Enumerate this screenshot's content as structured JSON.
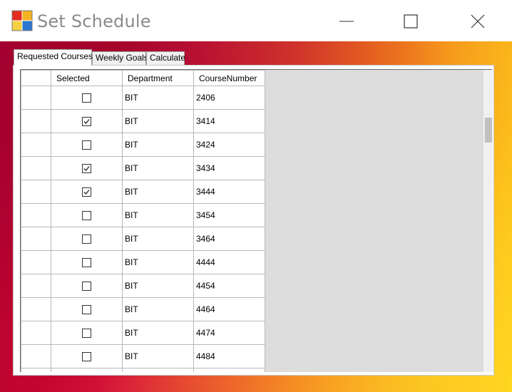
{
  "window": {
    "title": "Set Schedule",
    "accent_colors": [
      "#b70033",
      "#e8442b",
      "#ffd11a"
    ]
  },
  "tabs": [
    {
      "label": "Requested Courses",
      "active": true
    },
    {
      "label": "Weekly Goals",
      "active": false
    },
    {
      "label": "Calculate",
      "active": false
    }
  ],
  "grid": {
    "columns": [
      "Selected",
      "Department",
      "CourseNumber"
    ],
    "rows": [
      {
        "selected": false,
        "department": "BIT",
        "course_number": "2406"
      },
      {
        "selected": true,
        "department": "BIT",
        "course_number": "3414"
      },
      {
        "selected": false,
        "department": "BIT",
        "course_number": "3424"
      },
      {
        "selected": true,
        "department": "BIT",
        "course_number": "3434"
      },
      {
        "selected": true,
        "department": "BIT",
        "course_number": "3444"
      },
      {
        "selected": false,
        "department": "BIT",
        "course_number": "3454"
      },
      {
        "selected": false,
        "department": "BIT",
        "course_number": "3464"
      },
      {
        "selected": false,
        "department": "BIT",
        "course_number": "4444"
      },
      {
        "selected": false,
        "department": "BIT",
        "course_number": "4454"
      },
      {
        "selected": false,
        "department": "BIT",
        "course_number": "4464"
      },
      {
        "selected": false,
        "department": "BIT",
        "course_number": "4474"
      },
      {
        "selected": false,
        "department": "BIT",
        "course_number": "4484"
      },
      {
        "selected": false,
        "department": "",
        "course_number": ""
      }
    ]
  }
}
